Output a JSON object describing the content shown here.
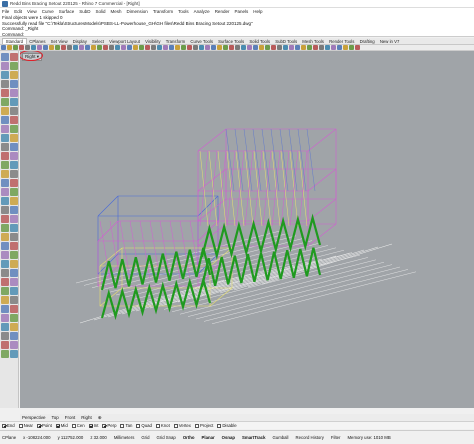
{
  "window": {
    "title": "Redd Bins Bracing Setout 220125 - Rhino 7 Commercial - [Right]"
  },
  "menu": [
    "File",
    "Edit",
    "View",
    "Curve",
    "Surface",
    "SubD",
    "Solid",
    "Mesh",
    "Dimension",
    "Transform",
    "Tools",
    "Analyze",
    "Render",
    "Panels",
    "Help"
  ],
  "command": {
    "history": [
      "Final objects were 1 skipped 0",
      "Successfully read file \"C:\\Tekla\\StructuresModels\\PSBS-LL-Powerhouse_GH\\GH files\\Redd Bins Bracing Setout 220125.dwg\"",
      "Command: _Right"
    ],
    "prompt": "Command:"
  },
  "tabs": [
    "Standard",
    "CPlanes",
    "Set View",
    "Display",
    "Select",
    "Viewport Layout",
    "Visibility",
    "Transform",
    "Curve Tools",
    "Surface Tools",
    "Solid Tools",
    "SubD Tools",
    "Mesh Tools",
    "Render Tools",
    "Drafting",
    "New in V7"
  ],
  "viewport": {
    "label": "Right",
    "label_arrow": "▾"
  },
  "view_tabs": [
    "Perspective",
    "Top",
    "Front",
    "Right",
    "⊕"
  ],
  "osnaps": [
    {
      "label": "End",
      "on": true
    },
    {
      "label": "Near",
      "on": false
    },
    {
      "label": "Point",
      "on": true
    },
    {
      "label": "Mid",
      "on": true
    },
    {
      "label": "Cen",
      "on": false
    },
    {
      "label": "Int",
      "on": true
    },
    {
      "label": "Perp",
      "on": true
    },
    {
      "label": "Tan",
      "on": false
    },
    {
      "label": "Quad",
      "on": false
    },
    {
      "label": "Knot",
      "on": false
    },
    {
      "label": "Vertex",
      "on": false
    },
    {
      "label": "Project",
      "on": false
    },
    {
      "label": "Disable",
      "on": false
    }
  ],
  "status": {
    "cplane": "CPlane",
    "x": "x -108224.000",
    "y": "y 112752.000",
    "z": "z 32.000",
    "units": "Millimeters",
    "layer": "Grid",
    "grid_snap": "Grid Snap",
    "ortho": "Ortho",
    "planar": "Planar",
    "osnap": "Osnap",
    "smarttrack": "SmartTrack",
    "gumball": "Gumball",
    "record_history": "Record History",
    "filter": "Filter",
    "memory": "Memory use: 1010 MB"
  },
  "colors": {
    "viewport_bg": "#a0a4a8",
    "zigzag": "#1f9a1f",
    "magenta": "#d060d0",
    "blue": "#4a6ad8",
    "yellow": "#e8e070",
    "white": "#f2f2f2",
    "highlight": "#e0202a"
  }
}
